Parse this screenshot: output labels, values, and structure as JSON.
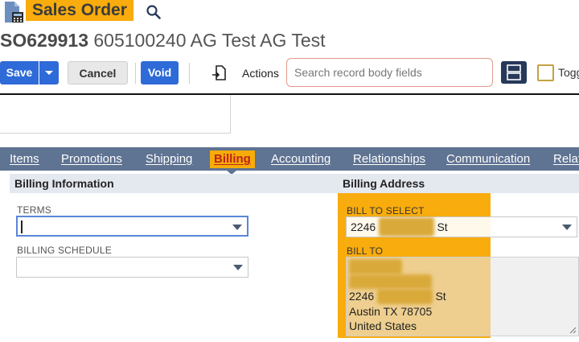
{
  "header": {
    "title": "Sales Order",
    "record_number": "SO629913",
    "record_name": "605100240 AG Test AG Test"
  },
  "toolbar": {
    "save": "Save",
    "cancel": "Cancel",
    "void": "Void",
    "actions": "Actions",
    "search_placeholder": "Search record body fields",
    "toggle_label": "Togg"
  },
  "tabs": [
    {
      "label": "Items",
      "active": false
    },
    {
      "label": "Promotions",
      "active": false
    },
    {
      "label": "Shipping",
      "active": false
    },
    {
      "label": "Billing",
      "active": true
    },
    {
      "label": "Accounting",
      "active": false
    },
    {
      "label": "Relationships",
      "active": false
    },
    {
      "label": "Communication",
      "active": false
    },
    {
      "label": "Relat",
      "active": false
    }
  ],
  "billing_info": {
    "header": "Billing Information",
    "terms_label": "TERMS",
    "terms_value": "",
    "schedule_label": "BILLING SCHEDULE",
    "schedule_value": ""
  },
  "billing_address": {
    "header": "Billing Address",
    "select_label": "BILL TO SELECT",
    "select_prefix": "2246",
    "select_suffix": "St",
    "billto_label": "BILL TO",
    "street_prefix": "2246",
    "street_suffix": "St",
    "city_line": "Austin TX 78705",
    "country": "United States"
  },
  "colors": {
    "accent_blue": "#2f6bd8",
    "highlight_orange": "#f9ac0d",
    "tab_bar": "#5f7392"
  }
}
